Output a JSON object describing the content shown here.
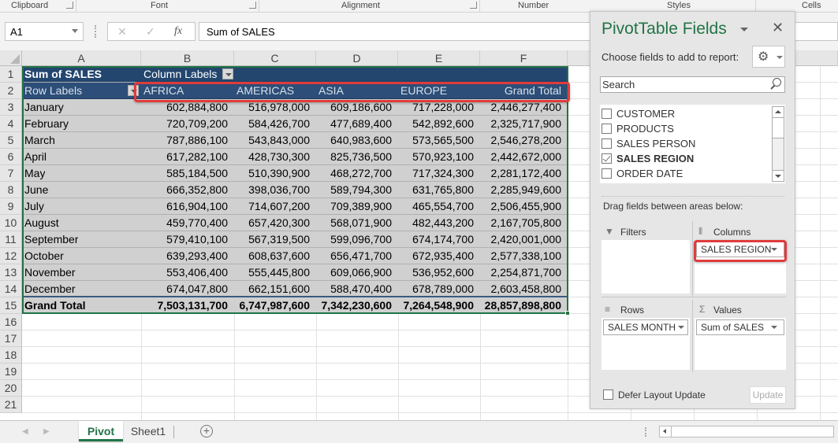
{
  "ribbon": {
    "groups": [
      "Clipboard",
      "Font",
      "Alignment",
      "Number",
      "Styles",
      "Cells"
    ]
  },
  "formula_bar": {
    "name_box": "A1",
    "cancel_icon": "✕",
    "enter_icon": "✓",
    "fx_label": "fx",
    "content": "Sum of SALES"
  },
  "columns": [
    "A",
    "B",
    "C",
    "D",
    "E",
    "F"
  ],
  "rows": [
    "1",
    "2",
    "3",
    "4",
    "5",
    "6",
    "7",
    "8",
    "9",
    "10",
    "11",
    "12",
    "13",
    "14",
    "15",
    "16",
    "17",
    "18",
    "19",
    "20",
    "21"
  ],
  "pivot": {
    "value_label": "Sum of SALES",
    "column_labels": "Column Labels",
    "row_labels": "Row Labels",
    "headers": [
      "AFRICA",
      "AMERICAS",
      "ASIA",
      "EUROPE",
      "Grand Total"
    ],
    "data": [
      {
        "month": "January",
        "values": [
          "602,884,800",
          "516,978,000",
          "609,186,600",
          "717,228,000",
          "2,446,277,400"
        ]
      },
      {
        "month": "February",
        "values": [
          "720,709,200",
          "584,426,700",
          "477,689,400",
          "542,892,600",
          "2,325,717,900"
        ]
      },
      {
        "month": "March",
        "values": [
          "787,886,100",
          "543,843,000",
          "640,983,600",
          "573,565,500",
          "2,546,278,200"
        ]
      },
      {
        "month": "April",
        "values": [
          "617,282,100",
          "428,730,300",
          "825,736,500",
          "570,923,100",
          "2,442,672,000"
        ]
      },
      {
        "month": "May",
        "values": [
          "585,184,500",
          "510,390,900",
          "468,272,700",
          "717,324,300",
          "2,281,172,400"
        ]
      },
      {
        "month": "June",
        "values": [
          "666,352,800",
          "398,036,700",
          "589,794,300",
          "631,765,800",
          "2,285,949,600"
        ]
      },
      {
        "month": "July",
        "values": [
          "616,904,100",
          "714,607,200",
          "709,389,900",
          "465,554,700",
          "2,506,455,900"
        ]
      },
      {
        "month": "August",
        "values": [
          "459,770,400",
          "657,420,300",
          "568,071,900",
          "482,443,200",
          "2,167,705,800"
        ]
      },
      {
        "month": "September",
        "values": [
          "579,410,100",
          "567,319,500",
          "599,096,700",
          "674,174,700",
          "2,420,001,000"
        ]
      },
      {
        "month": "October",
        "values": [
          "639,293,400",
          "608,637,600",
          "656,471,700",
          "672,935,400",
          "2,577,338,100"
        ]
      },
      {
        "month": "November",
        "values": [
          "553,406,400",
          "555,445,800",
          "609,066,900",
          "536,952,600",
          "2,254,871,700"
        ]
      },
      {
        "month": "December",
        "values": [
          "674,047,800",
          "662,151,600",
          "588,470,400",
          "678,789,000",
          "2,603,458,800"
        ]
      }
    ],
    "grand_total": {
      "label": "Grand Total",
      "values": [
        "7,503,131,700",
        "6,747,987,600",
        "7,342,230,600",
        "7,264,548,900",
        "28,857,898,800"
      ]
    }
  },
  "sheet_tabs": [
    {
      "label": "Pivot",
      "active": true
    },
    {
      "label": "Sheet1",
      "active": false
    }
  ],
  "panel": {
    "title": "PivotTable Fields",
    "close_icon": "✕",
    "choose_label": "Choose fields to add to report:",
    "gear_icon": "⚙",
    "search_placeholder": "Search",
    "fields": [
      {
        "label": "CUSTOMER",
        "checked": false
      },
      {
        "label": "PRODUCTS",
        "checked": false
      },
      {
        "label": "SALES PERSON",
        "checked": false
      },
      {
        "label": "SALES REGION",
        "checked": true
      },
      {
        "label": "ORDER DATE",
        "checked": false
      }
    ],
    "drag_label": "Drag fields between areas below:",
    "areas": {
      "filters": {
        "label": "Filters",
        "icon": "▼",
        "items": []
      },
      "columns": {
        "label": "Columns",
        "icon": "⦀",
        "items": [
          "SALES REGION"
        ]
      },
      "rows": {
        "label": "Rows",
        "icon": "≡",
        "items": [
          "SALES MONTH"
        ]
      },
      "values": {
        "label": "Values",
        "icon": "Σ",
        "items": [
          "Sum of SALES"
        ]
      }
    },
    "defer_label": "Defer Layout Update",
    "update_label": "Update"
  },
  "colors": {
    "accent": "#217346",
    "pivot_header": "#23466f",
    "highlight": "#e03c3c"
  }
}
